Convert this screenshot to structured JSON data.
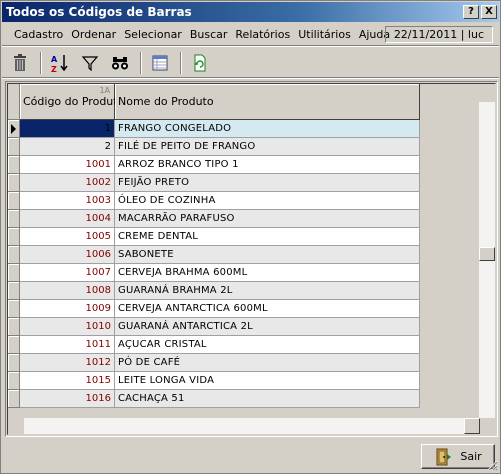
{
  "window": {
    "title": "Todos os Códigos de Barras",
    "help_btn": "?",
    "close_btn": "X"
  },
  "menu": {
    "items": [
      "Cadastro",
      "Ordenar",
      "Selecionar",
      "Buscar",
      "Relatórios",
      "Utilitários",
      "Ajuda"
    ],
    "status": "22/11/2011 | luc"
  },
  "toolbar": {
    "buttons": [
      "trash-icon",
      "sort-az-icon",
      "filter-icon",
      "binoculars-icon",
      "grid-view-icon",
      "refresh-icon"
    ]
  },
  "grid": {
    "columns": [
      "Código do Produto",
      "Nome do Produto"
    ],
    "sort_indicator": "1A",
    "rows": [
      {
        "code": "1",
        "name": "FRANGO CONGELADO"
      },
      {
        "code": "2",
        "name": "FILÉ DE PEITO DE FRANGO"
      },
      {
        "code": "1001",
        "name": "ARROZ BRANCO TIPO 1"
      },
      {
        "code": "1002",
        "name": "FEIJÃO PRETO"
      },
      {
        "code": "1003",
        "name": "ÓLEO DE COZINHA"
      },
      {
        "code": "1004",
        "name": "MACARRÃO PARAFUSO"
      },
      {
        "code": "1005",
        "name": "CREME DENTAL"
      },
      {
        "code": "1006",
        "name": "SABONETE"
      },
      {
        "code": "1007",
        "name": "CERVEJA BRAHMA 600ML"
      },
      {
        "code": "1008",
        "name": "GUARANÁ BRAHMA 2L"
      },
      {
        "code": "1009",
        "name": "CERVEJA ANTARCTICA 600ML"
      },
      {
        "code": "1010",
        "name": "GUARANÁ ANTARCTICA 2L"
      },
      {
        "code": "1011",
        "name": "AÇUCAR CRISTAL"
      },
      {
        "code": "1012",
        "name": "PÓ DE CAFÉ"
      },
      {
        "code": "1015",
        "name": "LEITE LONGA VIDA"
      },
      {
        "code": "1016",
        "name": "CACHAÇA 51"
      }
    ],
    "selected_index": 0
  },
  "footer": {
    "exit_label": "Sair"
  },
  "colors": {
    "title_bar": "#0a246a",
    "code_text": "#800000",
    "selected_row": "#d5eaf0"
  }
}
